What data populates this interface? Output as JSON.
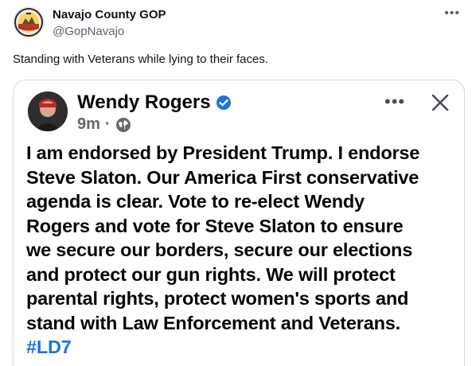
{
  "tweet": {
    "author_name": "Navajo County GOP",
    "author_handle": "@GopNavajo",
    "text": "Standing with Veterans while lying to their faces.",
    "avatar_icon": "county-seal-icon",
    "more_icon": "more-options-icon"
  },
  "media": {
    "name": "Wendy Rogers",
    "time": "9m",
    "dot": "·",
    "privacy_icon": "globe-icon",
    "verified_icon": "verified-badge-icon",
    "menu_icon": "ellipsis-icon",
    "close_icon": "close-icon",
    "body_lines": [
      "I am endorsed by President Trump. I endorse",
      "Steve Slaton. Our America First conservative",
      "agenda is clear. Vote to re-elect Wendy",
      "Rogers and vote for Steve Slaton to ensure",
      "we secure our borders, secure our elections",
      "and protect our gun rights. We will protect",
      "parental rights, protect women's sports and",
      "stand with Law Enforcement and Veterans."
    ],
    "hashtag": "#LD7"
  },
  "colors": {
    "text": "#0f1419",
    "secondary": "#536471",
    "hashtag": "#1b74e4",
    "verified": "#1b74e4"
  }
}
